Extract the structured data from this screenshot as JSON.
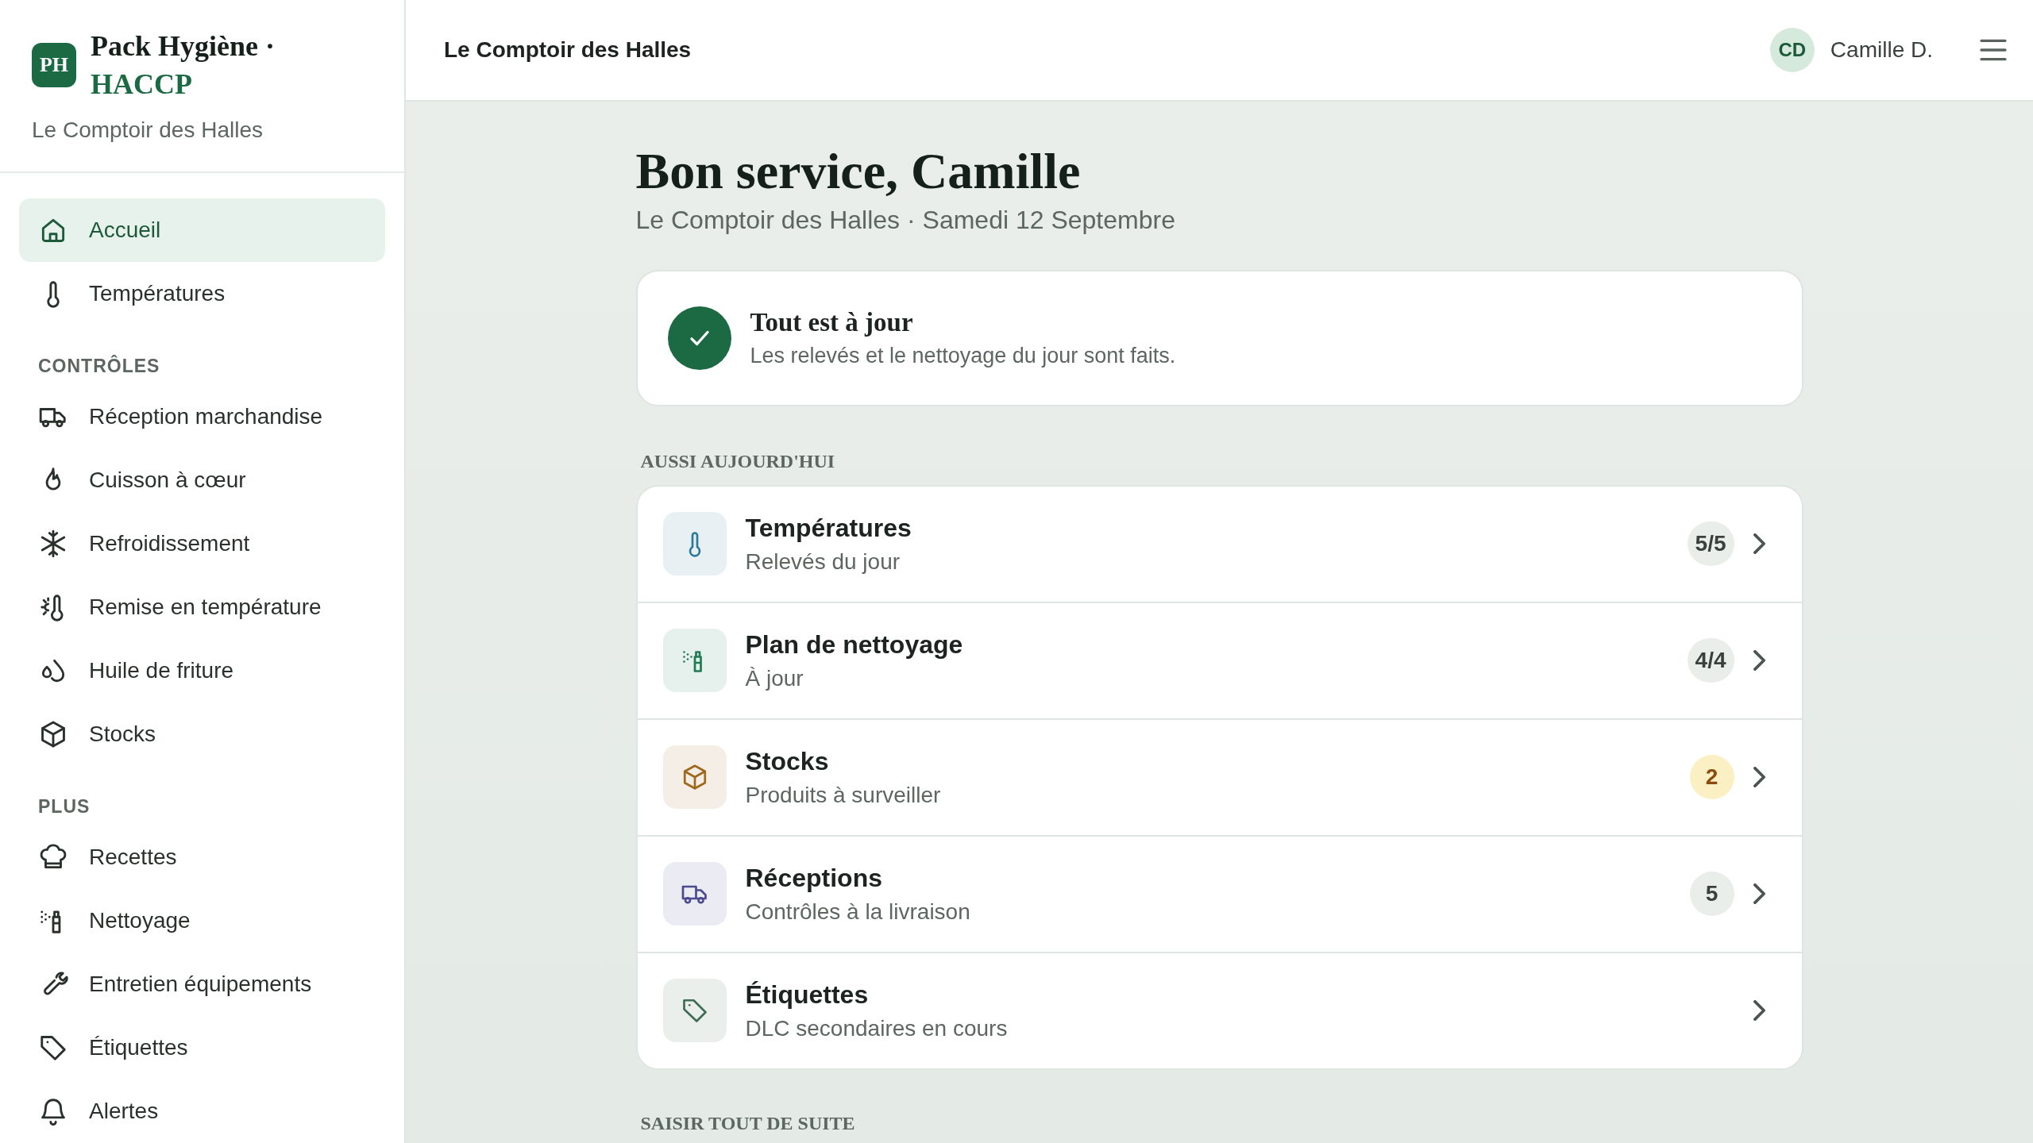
{
  "sidebar": {
    "logo": "PH",
    "app_name": "Pack Hygiène ·",
    "app_name_accent": "HACCP",
    "establishment": "Le Comptoir des Halles",
    "sections": [
      {
        "items": [
          {
            "label": "Accueil",
            "selected": true
          },
          {
            "label": "Températures",
            "selected": false
          }
        ]
      },
      {
        "heading": "CONTRÔLES",
        "items": [
          {
            "label": "Réception marchandise",
            "selected": false
          },
          {
            "label": "Cuisson à cœur",
            "selected": false
          },
          {
            "label": "Refroidissement",
            "selected": false
          },
          {
            "label": "Remise en température",
            "selected": false
          },
          {
            "label": "Huile de friture",
            "selected": false
          },
          {
            "label": "Stocks",
            "selected": false
          }
        ]
      },
      {
        "heading": "PLUS",
        "items": [
          {
            "label": "Recettes",
            "selected": false
          },
          {
            "label": "Nettoyage",
            "selected": false
          },
          {
            "label": "Entretien équipements",
            "selected": false
          },
          {
            "label": "Étiquettes",
            "selected": false
          },
          {
            "label": "Alertes",
            "selected": false
          }
        ]
      }
    ]
  },
  "header": {
    "title": "Le Comptoir des Halles",
    "user_initials": "CD",
    "user_name": "Camille D."
  },
  "main": {
    "greeting": "Bon service, Camille",
    "subtitle": "Le Comptoir des Halles · Samedi 12 Septembre",
    "status_card": {
      "title": "Tout est à jour",
      "text": "Les relevés et le nettoyage du jour sont faits."
    },
    "today_heading": "AUSSI AUJOURD'HUI",
    "today_rows": [
      {
        "title": "Températures",
        "subtitle": "Relevés du jour",
        "badge": "5/5",
        "alert": false,
        "color": "#2b7a9b"
      },
      {
        "title": "Plan de nettoyage",
        "subtitle": "À jour",
        "badge": "4/4",
        "alert": false,
        "color": "#1f7a55"
      },
      {
        "title": "Stocks",
        "subtitle": "Produits à surveiller",
        "badge": "2",
        "alert": true,
        "color": "#a0681c"
      },
      {
        "title": "Réceptions",
        "subtitle": "Contrôles à la livraison",
        "badge": "5",
        "alert": false,
        "color": "#4b4a8f"
      },
      {
        "title": "Étiquettes",
        "subtitle": "DLC secondaires en cours",
        "color": "#3f6e55"
      }
    ],
    "next_heading": "SAISIR TOUT DE SUITE"
  }
}
